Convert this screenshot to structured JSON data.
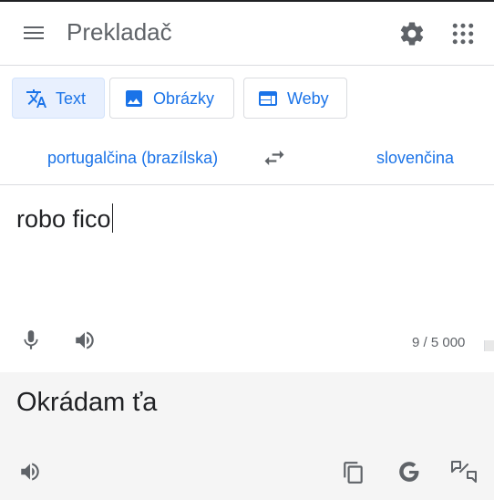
{
  "header": {
    "title": "Prekladač",
    "menu_icon": "hamburger-menu-icon",
    "settings_icon": "gear-icon",
    "apps_icon": "apps-grid-icon"
  },
  "modes": [
    {
      "label": "Text",
      "icon": "translate-icon",
      "active": true
    },
    {
      "label": "Obrázky",
      "icon": "image-icon",
      "active": false
    },
    {
      "label": "Weby",
      "icon": "web-icon",
      "active": false
    }
  ],
  "languages": {
    "source": "portugalčina (brazílska)",
    "target": "slovenčina",
    "swap_icon": "swap-arrows-icon"
  },
  "source": {
    "text": "robo fico",
    "char_count": "9 / 5 000"
  },
  "target": {
    "text": "Okrádam ťa"
  },
  "colors": {
    "accent": "#1a73e8",
    "icon_gray": "#5f6368",
    "active_tab_bg": "#e8f0fe",
    "output_bg": "#f5f5f5"
  }
}
